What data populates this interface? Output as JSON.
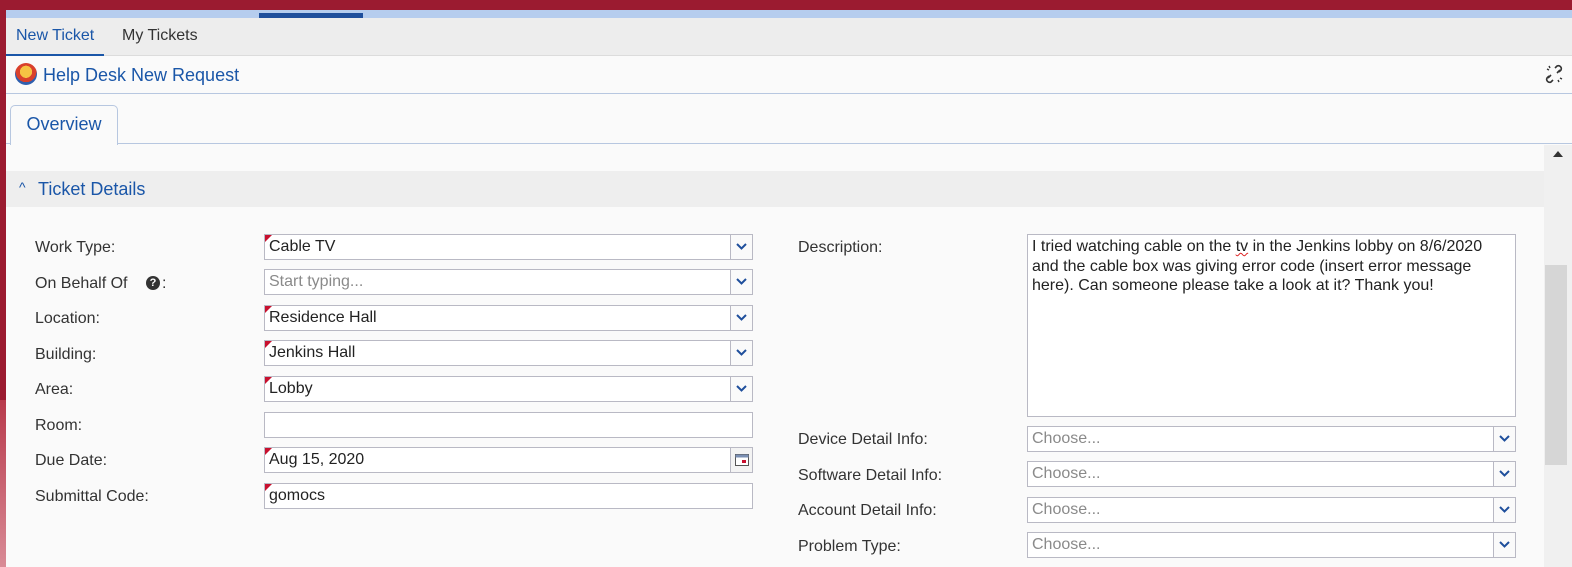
{
  "top_tabs": [
    {
      "label": "New Ticket",
      "active": true
    },
    {
      "label": "My Tickets",
      "active": false
    }
  ],
  "page": {
    "title": "Help Desk New Request"
  },
  "tabs": {
    "overview": "Overview"
  },
  "section": {
    "title": "Ticket Details"
  },
  "left_fields": [
    {
      "label": "Work Type:",
      "value": "Cable TV",
      "placeholder": "",
      "required": true,
      "control": "dropdown"
    },
    {
      "label": "On Behalf Of",
      "label_suffix": ":",
      "value": "",
      "placeholder": "Start typing...",
      "required": false,
      "control": "dropdown"
    },
    {
      "label": "Location:",
      "value": "Residence Hall",
      "placeholder": "",
      "required": true,
      "control": "dropdown"
    },
    {
      "label": "Building:",
      "value": "Jenkins Hall",
      "placeholder": "",
      "required": true,
      "control": "dropdown"
    },
    {
      "label": "Area:",
      "value": "Lobby",
      "placeholder": "",
      "required": true,
      "control": "dropdown"
    },
    {
      "label": "Room:",
      "value": "",
      "placeholder": "",
      "required": false,
      "control": "text"
    },
    {
      "label": "Due Date:",
      "value": "Aug 15, 2020",
      "placeholder": "",
      "required": true,
      "control": "date"
    },
    {
      "label": "Submittal Code:",
      "value": "gomocs",
      "placeholder": "",
      "required": true,
      "control": "text"
    }
  ],
  "description": {
    "label": "Description:",
    "text_before": "I tried watching cable on the ",
    "misspelled": "tv",
    "text_after": " in the Jenkins lobby on 8/6/2020 and the cable box was giving error code (insert error message here). Can someone please take a look at it? Thank you!"
  },
  "right_fields": [
    {
      "label": "Device Detail Info:",
      "placeholder": "Choose..."
    },
    {
      "label": "Software Detail Info:",
      "placeholder": "Choose..."
    },
    {
      "label": "Account Detail Info:",
      "placeholder": "Choose..."
    },
    {
      "label": "Problem Type:",
      "placeholder": "Choose..."
    }
  ],
  "colors": {
    "brand": "#9b1b30",
    "accent": "#1a56a8",
    "required_marker": "#c8102e"
  }
}
